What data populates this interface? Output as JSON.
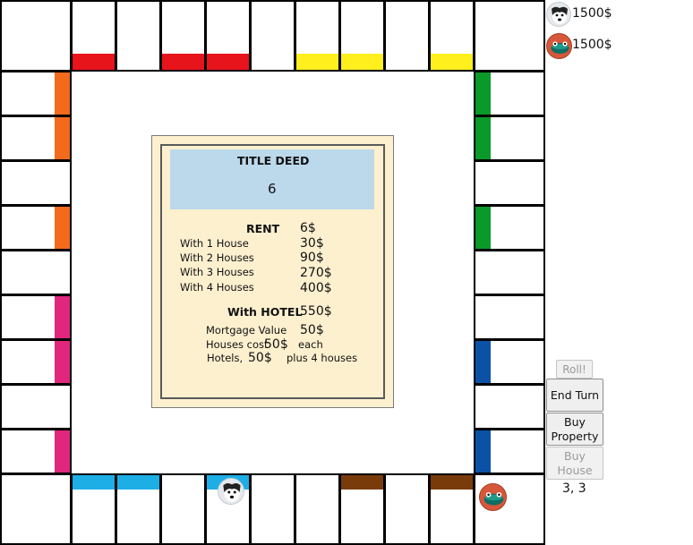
{
  "players": [
    {
      "name_icon": "dog-token-icon",
      "money": "1500$"
    },
    {
      "name_icon": "frog-token-icon",
      "money": "1500$"
    }
  ],
  "deed": {
    "title": "TITLE DEED",
    "property_name": "6",
    "rent_label": "RENT",
    "rent_value": "6$",
    "houses": [
      {
        "label": "With 1 House",
        "value": "30$"
      },
      {
        "label": "With 2 Houses",
        "value": "90$"
      },
      {
        "label": "With 3 Houses",
        "value": "270$"
      },
      {
        "label": "With 4 Houses",
        "value": "400$"
      }
    ],
    "hotel_label": "With HOTEL",
    "hotel_value": "550$",
    "mortgage_label": "Mortgage Value",
    "mortgage_value": "50$",
    "houses_cost_label": "Houses cost",
    "houses_cost_value": "50$",
    "houses_cost_suffix": "each",
    "hotels_label": "Hotels,",
    "hotels_value": "50$",
    "hotels_suffix": "plus 4 houses"
  },
  "buttons": {
    "roll": "Roll!",
    "end_turn": "End Turn",
    "buy_property": "Buy Property",
    "buy_house": "Buy House"
  },
  "dice": "3, 3",
  "colors": {
    "red": "#e8141b",
    "yellow": "#ffef1c",
    "green": "#0a9a2a",
    "orange": "#f26a1b",
    "pink": "#e1277d",
    "blue": "#0b52a7",
    "lightblue": "#1daee6",
    "brown": "#7a3b0b"
  }
}
